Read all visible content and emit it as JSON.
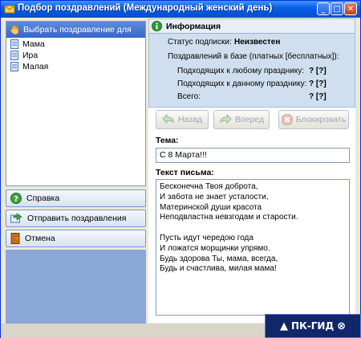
{
  "window": {
    "title": "Подбор поздравлений (Международный женский день)"
  },
  "left": {
    "header": "Выбрать поздравление для",
    "items": [
      {
        "label": "Мама"
      },
      {
        "label": "Ира"
      },
      {
        "label": "Малая"
      }
    ],
    "selected": "Мама"
  },
  "nav": {
    "help": "Справка",
    "send": "Отправить поздравления",
    "cancel": "Отмена"
  },
  "info": {
    "title": "Информация",
    "status_label": "Статус подписки:",
    "status_value": "Неизвестен",
    "db_label": "Поздравлений в базе (платных [бесплатных]):",
    "any_label": "Подходящих к любому празднику:",
    "any_value": "? [?]",
    "this_label": "Подходящих к данному празднику:",
    "this_value": "? [?]",
    "total_label": "Всего:",
    "total_value": "? [?]"
  },
  "actions": {
    "back": "Назад",
    "forward": "Вперед",
    "block": "Блокировать"
  },
  "subject": {
    "label": "Тема:",
    "value": "С 8 Марта!!!"
  },
  "letter": {
    "label": "Текст письма:",
    "text": "Бесконечна Твоя доброта,\nИ забота не знает усталости,\nМатеринской души красота\nНеподвластна невзгодам и старости.\n\nПусть идут чередою года\nИ ложатся морщинки упрямо.\nБудь здорова Ты, мама, всегда,\nБудь и счастлива, милая мама!"
  },
  "watermark": {
    "text": "ПК-ГИД",
    "prefix": "▲",
    "suffix": "⊗"
  },
  "colors": {
    "title_bar": "#0354d6",
    "panel_header": "#3566c4",
    "info_bg": "#cfdfef",
    "badge_bg": "#11276a"
  }
}
